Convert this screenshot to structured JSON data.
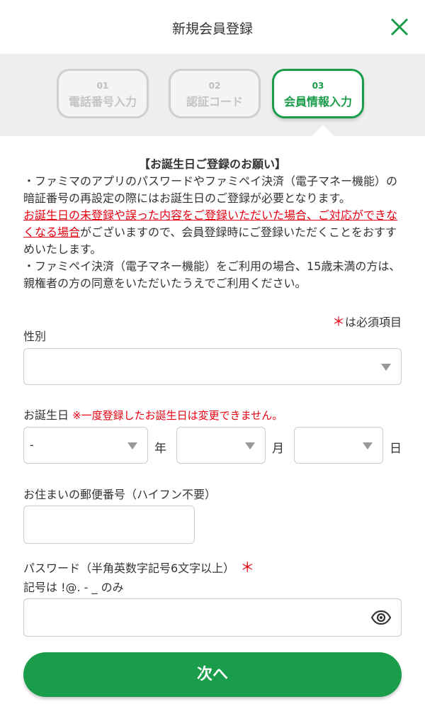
{
  "header": {
    "title": "新規会員登録"
  },
  "steps": [
    {
      "num": "01",
      "label": "電話番号入力"
    },
    {
      "num": "02",
      "label": "認証コード"
    },
    {
      "num": "03",
      "label": "会員情報入力"
    }
  ],
  "notice": {
    "title": "【お誕生日ご登録のお願い】",
    "para1": "・ファミマのアプリのパスワードやファミペイ決済（電子マネー機能）の暗証番号の再設定の際にはお誕生日のご登録が必要となります。",
    "para2_red": "お誕生日の未登録や誤った内容をご登録いただいた場合、ご対応ができなくなる場合",
    "para2_rest": "がございますので、会員登録時にご登録いただくことをおすすめいたします。",
    "para3": "・ファミペイ決済（電子マネー機能）をご利用の場合、15歳未満の方は、親権者の方の同意をいただいたうえでご利用ください。"
  },
  "required_note": {
    "mark": "＊",
    "text": "は必須項目"
  },
  "gender": {
    "label": "性別",
    "value": ""
  },
  "birthday": {
    "label": "お誕生日",
    "warning": "※一度登録したお誕生日は変更できません。",
    "year_value": "-",
    "month_value": "",
    "day_value": "",
    "year_unit": "年",
    "month_unit": "月",
    "day_unit": "日"
  },
  "postal": {
    "label": "お住まいの郵便番号（ハイフン不要）",
    "value": ""
  },
  "password": {
    "label": "パスワード（半角英数字記号6文字以上）",
    "required_mark": "＊",
    "hint": "記号は !@. - _ のみ",
    "value": ""
  },
  "next_button": "次へ",
  "colors": {
    "brand": "#1a9d4a",
    "required": "#e60012"
  }
}
